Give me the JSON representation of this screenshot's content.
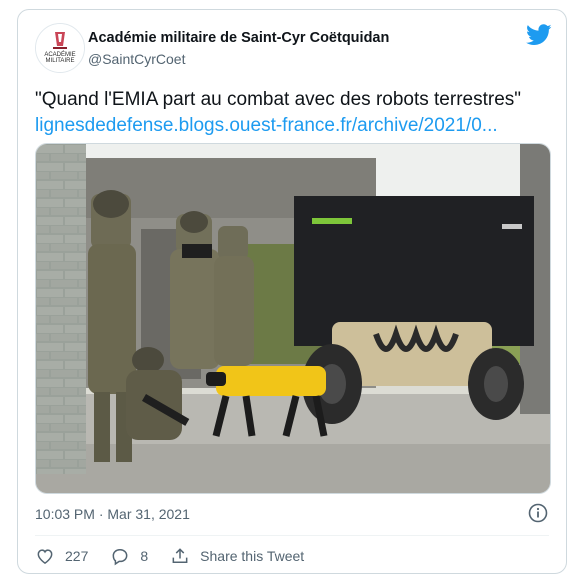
{
  "tweet": {
    "author_name": "Académie militaire de Saint-Cyr Coëtquidan",
    "author_handle": "@SaintCyrCoet",
    "avatar_text": [
      "ACADÉMIE",
      "MILITAIRE"
    ],
    "text": "\"Quand l'EMIA part au combat avec des robots terrestres\"",
    "link": "lignesdedefense.blogs.ouest-france.fr/archive/2021/0...",
    "timestamp": "10:03 PM · Mar 31, 2021"
  },
  "actions": {
    "likes_count": "227",
    "replies_count": "8",
    "share_label": "Share this Tweet"
  },
  "colors": {
    "twitter_blue": "#1d9bf0",
    "secondary_text": "#536471",
    "border": "#cfd9de"
  },
  "icons": {
    "brand": "twitter-bird-icon",
    "info": "info-icon",
    "like": "heart-icon",
    "reply": "reply-icon",
    "share": "share-icon"
  }
}
